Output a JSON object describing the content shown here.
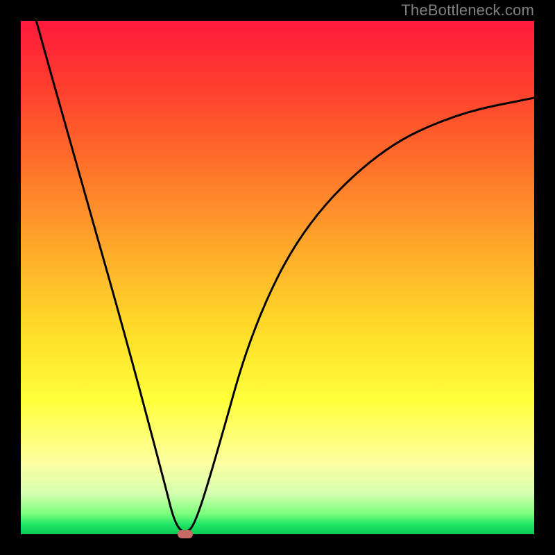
{
  "watermark": "TheBottleneck.com",
  "chart_data": {
    "type": "line",
    "title": "",
    "xlabel": "",
    "ylabel": "",
    "xlim": [
      0,
      100
    ],
    "ylim": [
      0,
      100
    ],
    "series": [
      {
        "name": "curve",
        "x": [
          3,
          10,
          20,
          28,
          30,
          32,
          34,
          38,
          45,
          55,
          70,
          85,
          100
        ],
        "values": [
          100,
          75,
          40,
          10,
          2,
          0,
          2,
          15,
          40,
          60,
          75,
          82,
          85
        ]
      }
    ],
    "marker": {
      "x": 32,
      "y": 0
    },
    "gradient_stops": [
      {
        "pct": 0,
        "color": "#ff1a3c"
      },
      {
        "pct": 50,
        "color": "#ffd22a"
      },
      {
        "pct": 90,
        "color": "#fdffa0"
      },
      {
        "pct": 100,
        "color": "#07c94f"
      }
    ]
  }
}
